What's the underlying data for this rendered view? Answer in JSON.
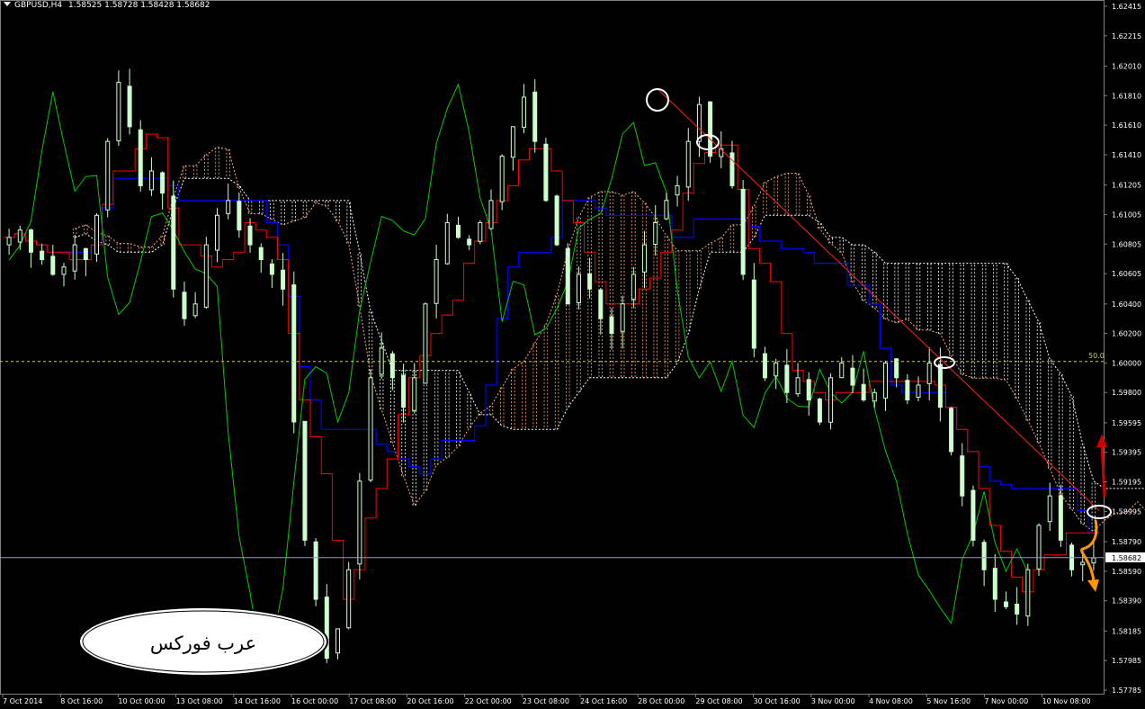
{
  "chart_header": {
    "symbol_tf": "GBPUSD,H4",
    "ohlc": "1.58525 1.58728 1.58428 1.58682"
  },
  "watermark": {
    "text": "عرب فوركس"
  },
  "price_marker": {
    "current_price": "1.58682",
    "level_label": "50.0",
    "level_price": 1.6001
  },
  "colors": {
    "background": "#000000",
    "candles": "#ccffcc",
    "tenkan": "#ff0000",
    "kijun": "#0000ff",
    "chikou": "#00cc00",
    "cloud_bull": "#ffaa77",
    "cloud_bear": "#ffffff",
    "trendline": "#ff2222",
    "arrow_up": "#cc0000",
    "arrow_down": "#ff9900",
    "level_line": "#cccc66"
  },
  "chart_data": {
    "type": "candlestick",
    "y_axis": {
      "min": 1.57785,
      "max": 1.62415,
      "ticks": [
        "1.62415",
        "1.62215",
        "1.62010",
        "1.61810",
        "1.61610",
        "1.61410",
        "1.61205",
        "1.61005",
        "1.60805",
        "1.60605",
        "1.60400",
        "1.60200",
        "1.60000",
        "1.59800",
        "1.59595",
        "1.59395",
        "1.59195",
        "1.58995",
        "1.58790",
        "1.58590",
        "1.58390",
        "1.58185",
        "1.57985",
        "1.57785"
      ]
    },
    "x_axis": {
      "ticks": [
        "7 Oct 2014",
        "8 Oct 16:00",
        "10 Oct 00:00",
        "13 Oct 08:00",
        "14 Oct 16:00",
        "16 Oct 00:00",
        "17 Oct 08:00",
        "20 Oct 16:00",
        "22 Oct 00:00",
        "23 Oct 08:00",
        "24 Oct 16:00",
        "28 Oct 00:00",
        "29 Oct 08:00",
        "30 Oct 16:00",
        "3 Nov 00:00",
        "4 Nov 08:00",
        "5 Nov 16:00",
        "7 Nov 00:00",
        "10 Nov 08:00"
      ]
    },
    "candles_close": [
      1.6085,
      1.609,
      1.6075,
      1.607,
      1.606,
      1.6065,
      1.608,
      1.607,
      1.61,
      1.615,
      1.619,
      1.616,
      1.612,
      1.613,
      1.6115,
      1.605,
      1.603,
      1.604,
      1.608,
      1.61,
      1.611,
      1.609,
      1.608,
      1.607,
      1.606,
      1.605,
      1.596,
      1.588,
      1.584,
      1.58,
      1.582,
      1.586,
      1.592,
      1.599,
      1.601,
      1.599,
      1.597,
      1.599,
      1.604,
      1.607,
      1.6095,
      1.6085,
      1.608,
      1.6095,
      1.611,
      1.614,
      1.616,
      1.618,
      1.615,
      1.611,
      1.608,
      1.604,
      1.606,
      1.605,
      1.603,
      1.602,
      1.604,
      1.606,
      1.608,
      1.6095,
      1.611,
      1.612,
      1.615,
      1.6175,
      1.614,
      1.6145,
      1.612,
      1.606,
      1.601,
      1.599,
      1.6,
      1.598,
      1.599,
      1.5975,
      1.596,
      1.599,
      1.6,
      1.5985,
      1.5975,
      1.598,
      1.6,
      1.599,
      1.5975,
      1.5985,
      1.6,
      1.597,
      1.594,
      1.591,
      1.588,
      1.586,
      1.584,
      1.5835,
      1.583,
      1.586,
      1.589,
      1.591,
      1.588,
      1.586,
      1.5865,
      1.5868
    ],
    "trendline": {
      "from_price": 1.6185,
      "to_price": 1.59
    }
  }
}
